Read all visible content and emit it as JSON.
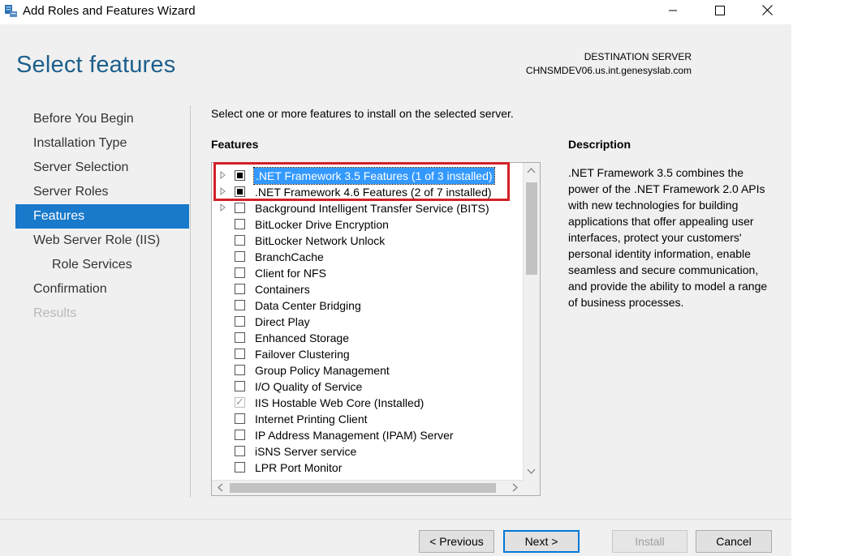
{
  "window": {
    "title": "Add Roles and Features Wizard"
  },
  "header": {
    "page_title": "Select features",
    "destination_label": "DESTINATION SERVER",
    "destination_server": "CHNSMDEV06.us.int.genesyslab.com"
  },
  "nav": {
    "items": [
      {
        "label": "Before You Begin",
        "state": "normal"
      },
      {
        "label": "Installation Type",
        "state": "normal"
      },
      {
        "label": "Server Selection",
        "state": "normal"
      },
      {
        "label": "Server Roles",
        "state": "normal"
      },
      {
        "label": "Features",
        "state": "active"
      },
      {
        "label": "Web Server Role (IIS)",
        "state": "normal"
      },
      {
        "label": "Role Services",
        "state": "sub"
      },
      {
        "label": "Confirmation",
        "state": "normal"
      },
      {
        "label": "Results",
        "state": "disabled"
      }
    ]
  },
  "main": {
    "instruction": "Select one or more features to install on the selected server.",
    "features_heading": "Features",
    "features": [
      {
        "label": ".NET Framework 3.5 Features (1 of 3 installed)",
        "expandable": true,
        "check": "partial",
        "selected": true
      },
      {
        "label": ".NET Framework 4.6 Features (2 of 7 installed)",
        "expandable": true,
        "check": "partial",
        "selected": false
      },
      {
        "label": "Background Intelligent Transfer Service (BITS)",
        "expandable": true,
        "check": "none",
        "selected": false
      },
      {
        "label": "BitLocker Drive Encryption",
        "expandable": false,
        "check": "none",
        "selected": false
      },
      {
        "label": "BitLocker Network Unlock",
        "expandable": false,
        "check": "none",
        "selected": false
      },
      {
        "label": "BranchCache",
        "expandable": false,
        "check": "none",
        "selected": false
      },
      {
        "label": "Client for NFS",
        "expandable": false,
        "check": "none",
        "selected": false
      },
      {
        "label": "Containers",
        "expandable": false,
        "check": "none",
        "selected": false
      },
      {
        "label": "Data Center Bridging",
        "expandable": false,
        "check": "none",
        "selected": false
      },
      {
        "label": "Direct Play",
        "expandable": false,
        "check": "none",
        "selected": false
      },
      {
        "label": "Enhanced Storage",
        "expandable": false,
        "check": "none",
        "selected": false
      },
      {
        "label": "Failover Clustering",
        "expandable": false,
        "check": "none",
        "selected": false
      },
      {
        "label": "Group Policy Management",
        "expandable": false,
        "check": "none",
        "selected": false
      },
      {
        "label": "I/O Quality of Service",
        "expandable": false,
        "check": "none",
        "selected": false
      },
      {
        "label": "IIS Hostable Web Core (Installed)",
        "expandable": false,
        "check": "checked-disabled",
        "selected": false
      },
      {
        "label": "Internet Printing Client",
        "expandable": false,
        "check": "none",
        "selected": false
      },
      {
        "label": "IP Address Management (IPAM) Server",
        "expandable": false,
        "check": "none",
        "selected": false
      },
      {
        "label": "iSNS Server service",
        "expandable": false,
        "check": "none",
        "selected": false
      },
      {
        "label": "LPR Port Monitor",
        "expandable": false,
        "check": "none",
        "selected": false
      }
    ],
    "description_heading": "Description",
    "description": ".NET Framework 3.5 combines the power of the .NET Framework 2.0 APIs with new technologies for building applications that offer appealing user interfaces, protect your customers' personal identity information, enable seamless and secure communication, and provide the ability to model a range of business processes."
  },
  "footer": {
    "previous_label": "< Previous",
    "next_label": "Next >",
    "install_label": "Install",
    "cancel_label": "Cancel"
  },
  "colors": {
    "accent": "#1979ca",
    "title": "#1c5f8c",
    "highlight": "#d42028"
  },
  "icons": {
    "app": "server-manager-icon",
    "minimize": "minimize-icon",
    "maximize": "maximize-icon",
    "close": "close-icon"
  }
}
